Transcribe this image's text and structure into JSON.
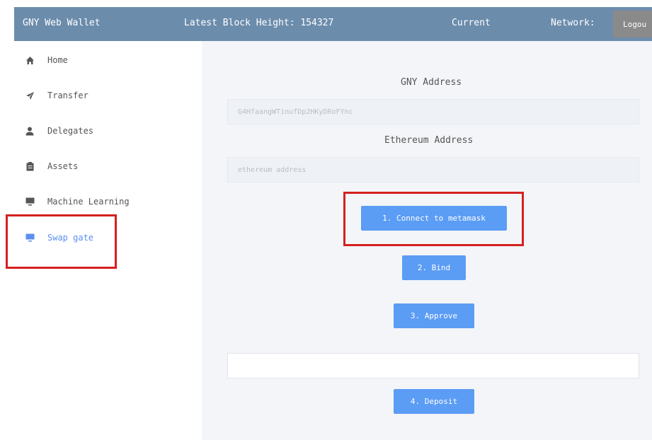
{
  "header": {
    "app_title": "GNY Web Wallet",
    "block_height": "Latest Block Height: 154327",
    "current": "Current",
    "network": "Network:",
    "logout_label": "Logou"
  },
  "sidebar": {
    "items": [
      {
        "label": "Home",
        "icon": "home-icon"
      },
      {
        "label": "Transfer",
        "icon": "send-icon"
      },
      {
        "label": "Delegates",
        "icon": "user-icon"
      },
      {
        "label": "Assets",
        "icon": "clipboard-icon"
      },
      {
        "label": "Machine Learning",
        "icon": "monitor-icon"
      },
      {
        "label": "Swap gate",
        "icon": "monitor-icon",
        "active": true
      }
    ]
  },
  "main": {
    "gny_address_label": "GNY Address",
    "gny_address_value": "G4HfaangWTinufDp2HKyDRoFYnc",
    "ethereum_address_label": "Ethereum Address",
    "ethereum_address_placeholder": "ethereum address",
    "connect_button": "1. Connect to metamask",
    "bind_button": "2. Bind",
    "approve_button": "3. Approve",
    "amount_value": "",
    "deposit_button": "4. Deposit"
  },
  "colors": {
    "header_bg": "#6c8cac",
    "accent": "#5b9cf5",
    "highlight": "#d62020"
  }
}
